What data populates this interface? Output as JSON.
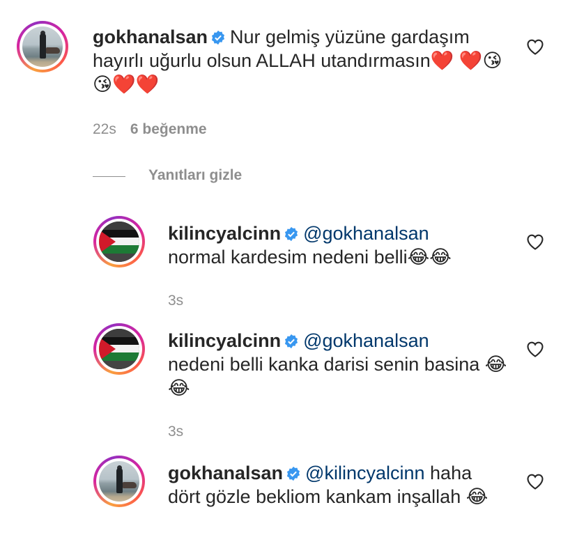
{
  "comments": [
    {
      "username": "gokhanalsan",
      "text": "Nur gelmiş yüzüne gardaşım hayırlı uğurlu olsun ALLAH utandırmasın❤️ ❤️😘😘❤️❤️",
      "time": "22s",
      "likes": "6 beğenme",
      "avatar": "lake-photo",
      "icon": "heart-outline"
    }
  ],
  "hide_replies_label": "Yanıtları gizle",
  "replies": [
    {
      "username": "kilincyalcinn",
      "mention": "@gokhanalsan",
      "text": "normal kardesim nedeni belli😂😂",
      "time": "3s",
      "avatar": "flag-photo"
    },
    {
      "username": "kilincyalcinn",
      "mention": "@gokhanalsan",
      "text": "nedeni belli kanka darisi senin basina 😂😂",
      "time": "3s",
      "avatar": "flag-photo"
    },
    {
      "username": "gokhanalsan",
      "mention": "@kilincyalcinn",
      "text": "haha dört gözle bekliom kankam inşallah 😂",
      "avatar": "lake-photo"
    }
  ],
  "colors": {
    "link": "#00376b",
    "muted": "#8e8e8e",
    "verified": "#3897f0"
  }
}
